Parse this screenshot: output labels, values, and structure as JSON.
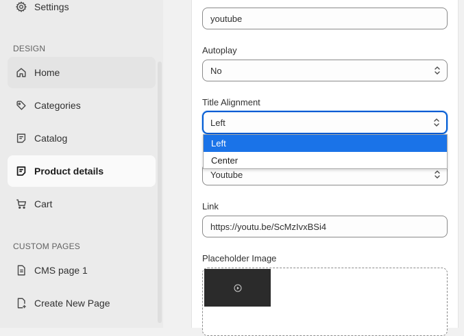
{
  "sidebar": {
    "settings_label": "Settings",
    "design_section": "DESIGN",
    "items": [
      {
        "label": "Home",
        "icon": "home-icon"
      },
      {
        "label": "Categories",
        "icon": "tag-icon"
      },
      {
        "label": "Catalog",
        "icon": "catalog-icon"
      },
      {
        "label": "Product details",
        "icon": "product-details-icon"
      },
      {
        "label": "Cart",
        "icon": "cart-icon"
      }
    ],
    "custom_section": "CUSTOM PAGES",
    "custom_items": [
      {
        "label": "CMS page 1",
        "icon": "page-icon"
      },
      {
        "label": "Create New Page",
        "icon": "new-page-icon"
      }
    ]
  },
  "form": {
    "title_value": "youtube",
    "autoplay_label": "Autoplay",
    "autoplay_value": "No",
    "alignment_label": "Title Alignment",
    "alignment_value": "Left",
    "alignment_options": [
      "Left",
      "Center"
    ],
    "provider_value": "Youtube",
    "link_label": "Link",
    "link_value": "https://youtu.be/ScMzIvxBSi4",
    "placeholder_label": "Placeholder Image"
  },
  "colors": {
    "accent": "#005bd3",
    "option_highlight": "#1a73e8"
  }
}
